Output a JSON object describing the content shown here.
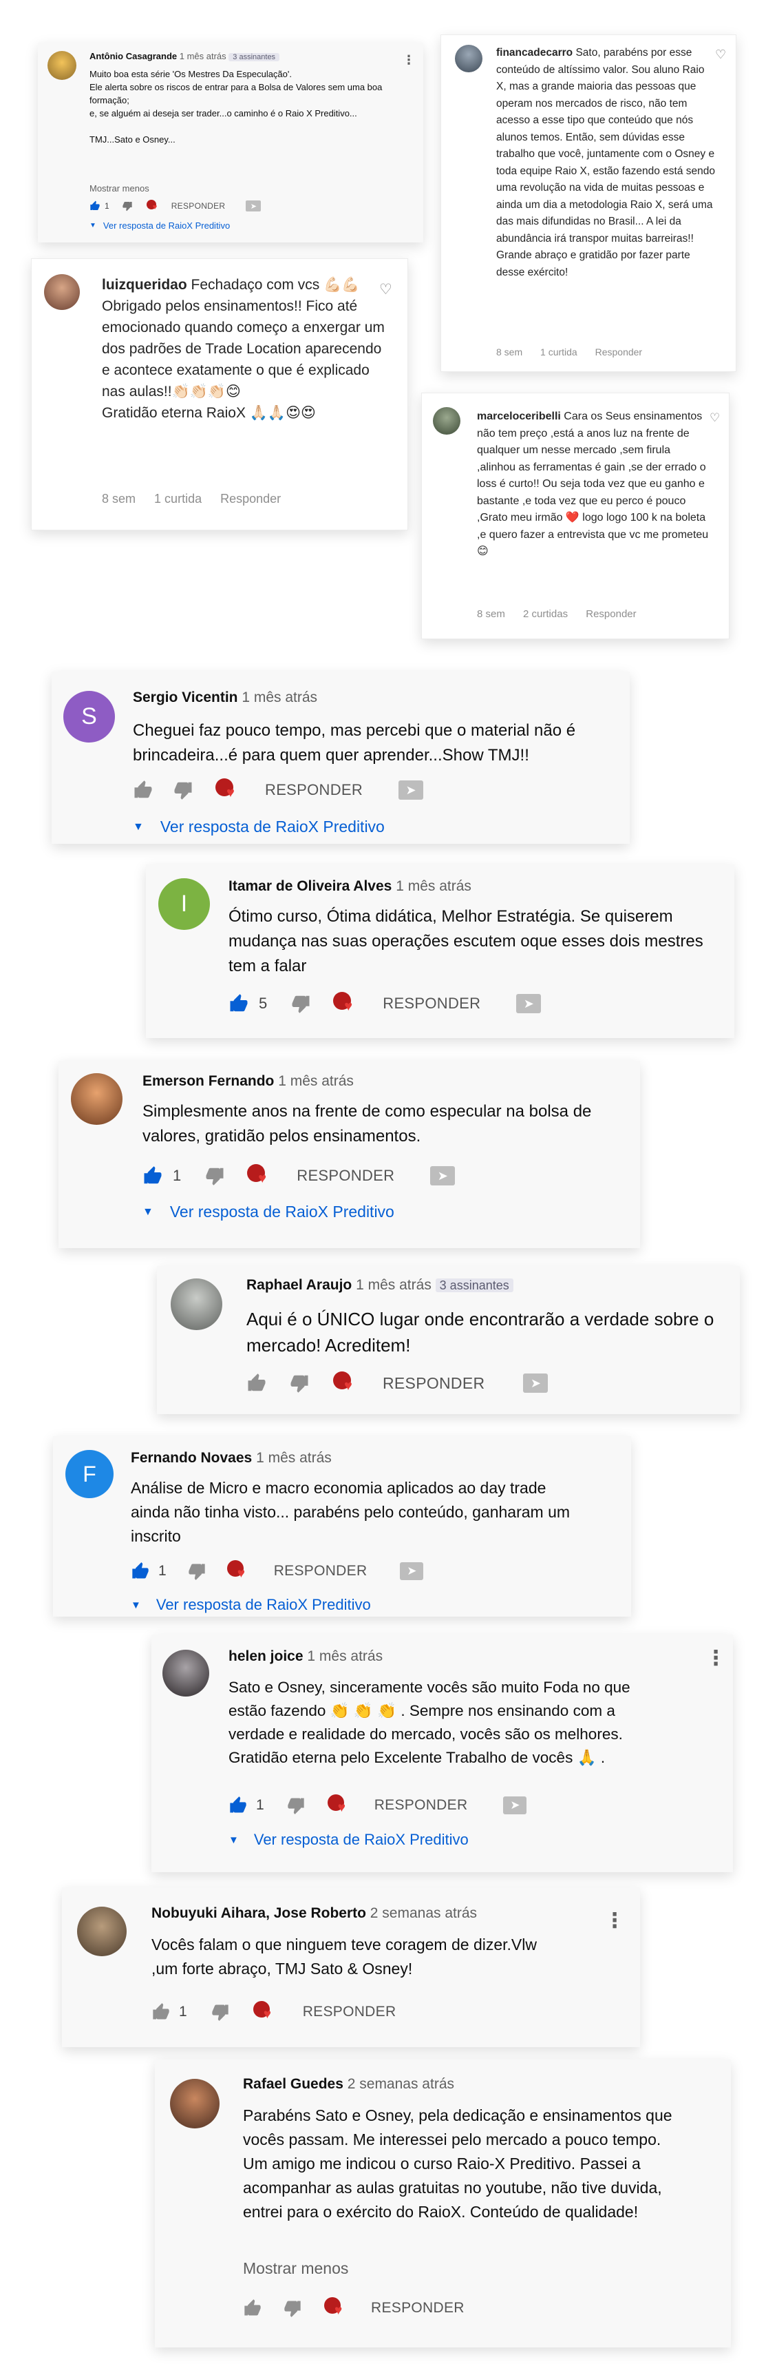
{
  "comments": [
    {
      "author": "Antônio Casagrande",
      "time": "1 mês atrás",
      "subscribers": "3 assinantes",
      "text": "Muito boa esta série 'Os Mestres Da Especulação'.\nEle alerta sobre os riscos de entrar para a Bolsa de Valores sem uma boa formação;\ne, se alguém ai deseja ser trader...o caminho é o Raio X Preditivo...\n\nTMJ...Sato e Osney...",
      "show_less": "Mostrar menos",
      "likes": "1",
      "reply": "RESPONDER",
      "view_replies": "Ver resposta de RaioX Preditivo"
    },
    {
      "author": "Sergio Vicentin",
      "time": "1 mês atrás",
      "avatar_letter": "S",
      "avatar_color": "#8e5cc4",
      "text": "Cheguei faz pouco tempo, mas percebi que o material não é brincadeira...é para quem quer aprender...Show TMJ!!",
      "reply": "RESPONDER",
      "view_replies": "Ver resposta de RaioX Preditivo"
    },
    {
      "author": "Itamar de Oliveira Alves",
      "time": "1 mês atrás",
      "avatar_letter": "I",
      "avatar_color": "#7cb342",
      "text": "Ótimo curso, Ótima didática, Melhor Estratégia. Se quiserem mudança nas suas operações escutem oque esses dois mestres tem a falar",
      "likes": "5",
      "reply": "RESPONDER"
    },
    {
      "author": "Emerson Fernando",
      "time": "1 mês atrás",
      "text": "Simplesmente anos na frente de como especular na bolsa de valores, gratidão pelos ensinamentos.",
      "likes": "1",
      "reply": "RESPONDER",
      "view_replies": "Ver resposta de RaioX Preditivo"
    },
    {
      "author": "Raphael Araujo",
      "time": "1 mês atrás",
      "subscribers": "3 assinantes",
      "text": "Aqui é o ÚNICO lugar onde encontrarão a verdade sobre o mercado! Acreditem!",
      "reply": "RESPONDER"
    },
    {
      "author": "Fernando Novaes",
      "time": "1 mês atrás",
      "avatar_letter": "F",
      "avatar_color": "#1e88e5",
      "text": "Análise de Micro e macro economia aplicados ao day trade ainda não tinha visto... parabéns pelo conteúdo, ganharam um inscrito",
      "likes": "1",
      "reply": "RESPONDER",
      "view_replies": "Ver resposta de RaioX Preditivo"
    },
    {
      "author": "helen joice",
      "time": "1 mês atrás",
      "text": "Sato e Osney, sinceramente vocês são muito Foda no que estão fazendo 👏 👏 👏 . Sempre nos ensinando com a verdade e realidade do mercado, vocês são os melhores. Gratidão eterna pelo Excelente Trabalho de vocês 🙏 .",
      "likes": "1",
      "reply": "RESPONDER",
      "view_replies": "Ver resposta de RaioX Preditivo"
    },
    {
      "author": "Nobuyuki Aihara, Jose Roberto",
      "time": "2 semanas atrás",
      "text": "Vocês  falam o que ninguem teve coragem de dizer.Vlw ,um forte abraço, TMJ Sato & Osney!",
      "likes": "1",
      "reply": "RESPONDER"
    },
    {
      "author": "Rafael Guedes",
      "time": "2 semanas atrás",
      "text": "Parabéns Sato e Osney, pela dedicação e ensinamentos que vocês passam.  Me interessei pelo mercado a pouco tempo. Um amigo me indicou o curso Raio-X Preditivo. Passei a acompanhar as aulas gratuitas no youtube,  não tive  duvida, entrei para o exército do RaioX.  Conteúdo de qualidade!",
      "show_less": "Mostrar menos",
      "reply": "RESPONDER"
    }
  ],
  "instagram": [
    {
      "user": "financadecarro",
      "text": "Sato, parabéns por esse conteúdo de altíssimo valor. Sou aluno Raio X, mas a grande maioria das pessoas que operam nos mercados de risco, não tem acesso a esse tipo que conteúdo que nós alunos temos. Então, sem dúvidas esse trabalho que você, juntamente com o Osney e toda equipe Raio X, estão fazendo está sendo uma revolução na vida de muitas pessoas e ainda um dia a metodologia Raio X, será uma das mais difundidas no Brasil... A lei da abundância irá transpor muitas barreiras!! Grande abraço e gratidão por fazer parte desse exército!",
      "time": "8 sem",
      "likes": "1 curtida",
      "reply": "Responder"
    },
    {
      "user": "luizqueridao",
      "text": "Fechadaço com vcs 💪🏻💪🏻\nObrigado pelos ensinamentos!! Fico até emocionado quando começo a enxergar um dos padrões de Trade Location aparecendo e acontece exatamente o que é explicado nas aulas!!👏🏻👏🏻👏🏻😊\nGratidão eterna RaioX 🙏🏻🙏🏻😍😍",
      "time": "8 sem",
      "likes": "1 curtida",
      "reply": "Responder"
    },
    {
      "user": "marceloceribelli",
      "text": "Cara os Seus ensinamentos não tem preço ,está a anos luz na frente de qualquer um nesse mercado ,sem firula ,alinhou as ferramentas é gain ,se der errado o loss é curto!! Ou seja toda vez que eu ganho e bastante ,e toda vez que eu perco é pouco ,Grato meu irmão ❤️ logo logo 100 k na boleta ,e quero fazer a entrevista que vc me prometeu 😊",
      "time": "8 sem",
      "likes": "2 curtidas",
      "reply": "Responder"
    }
  ]
}
